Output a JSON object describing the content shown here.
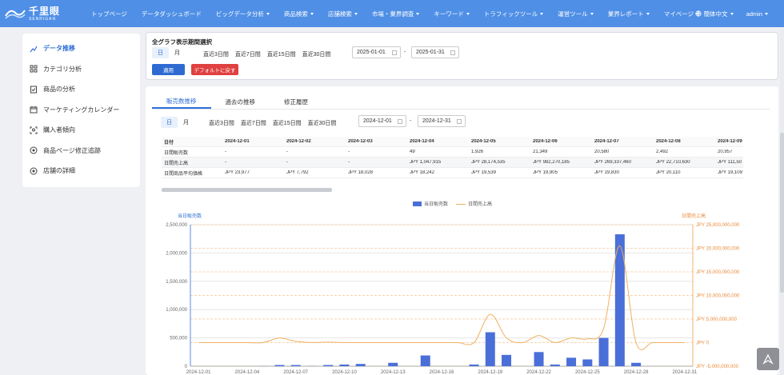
{
  "brand": {
    "name": "千里眼",
    "sub": "SENRIGAN"
  },
  "nav": [
    {
      "label": "トップページ",
      "dropdown": false
    },
    {
      "label": "データダッシュボード",
      "dropdown": false
    },
    {
      "label": "ビッグデータ分析",
      "dropdown": true
    },
    {
      "label": "商品検索",
      "dropdown": true
    },
    {
      "label": "店舗検索",
      "dropdown": true
    },
    {
      "label": "市場・業界調査",
      "dropdown": true
    },
    {
      "label": "キーワード",
      "dropdown": true
    },
    {
      "label": "トラフィックツール",
      "dropdown": true
    },
    {
      "label": "運営ツール",
      "dropdown": true
    },
    {
      "label": "業界レポート",
      "dropdown": true
    },
    {
      "label": "マイページ",
      "dropdown": true
    }
  ],
  "header_right": {
    "language": "簡体中文",
    "user": "admin"
  },
  "sidebar": [
    {
      "label": "データ推移",
      "icon": "chart-line-icon",
      "active": true
    },
    {
      "label": "カテゴリ分析",
      "icon": "grid-icon",
      "active": false
    },
    {
      "label": "商品の分析",
      "icon": "clipboard-check-icon",
      "active": false
    },
    {
      "label": "マーケティングカレンダー",
      "icon": "calendar-icon",
      "active": false
    },
    {
      "label": "購入者傾向",
      "icon": "scan-user-icon",
      "active": false
    },
    {
      "label": "商品ページ修正追跡",
      "icon": "target-icon",
      "active": false
    },
    {
      "label": "店舗の詳細",
      "icon": "target-icon",
      "active": false
    }
  ],
  "global_range": {
    "title": "全グラフ表示期間選択",
    "granularity": [
      "日",
      "月"
    ],
    "quick": [
      "直近3日間",
      "直近7日間",
      "直近15日間",
      "直近30日間"
    ],
    "start": "2025-01-01",
    "end": "2025-01-31",
    "separator": "-",
    "apply_label": "適用",
    "reset_label": "デフォルトに戻す"
  },
  "tabs": [
    "販売数推移",
    "過去の推移",
    "修正履歴"
  ],
  "local_range": {
    "granularity": [
      "日",
      "月"
    ],
    "quick": [
      "直近3日間",
      "直近7日間",
      "直近15日間",
      "直近30日間"
    ],
    "start": "2024-12-01",
    "end": "2024-12-31",
    "separator": "-"
  },
  "table": {
    "header": [
      "日付",
      "2024-12-01",
      "2024-12-02",
      "2024-12-03",
      "2024-12-04",
      "2024-12-05",
      "2024-12-06",
      "2024-12-07",
      "2024-12-08",
      "2024-12-09"
    ],
    "rows": [
      [
        "日間販売数",
        "-",
        "-",
        "-",
        "49",
        "1,926",
        "21,349",
        "20,580",
        "2,492",
        "20,957"
      ],
      [
        "日間売上高",
        "-",
        "-",
        "-",
        "JPY 1,047,915",
        "JPY 28,174,535",
        "JPY 982,270,185",
        "JPY 269,337,460",
        "JPY 22,710,630",
        "JPY 111,50"
      ],
      [
        "日間商品平均価格",
        "JPY 23,977",
        "JPY 7,792",
        "JPY 18,028",
        "JPY 18,242",
        "JPY 19,539",
        "JPY 19,905",
        "JPY 19,830",
        "JPY 20,110",
        "JPY 19,109"
      ]
    ]
  },
  "chart_data": {
    "type": "bar",
    "legend": [
      "当日販売数",
      "日間売上高"
    ],
    "legend_position": "top-center",
    "y_left_label": "当日販売数",
    "y_right_label": "日間売上高",
    "y_left_ticks": [
      "0",
      "500,000",
      "1,000,000",
      "1,500,000",
      "2,000,000",
      "2,500,000"
    ],
    "y_right_ticks": [
      "JPY -5,000,000,000",
      "JPY 0",
      "JPY 5,000,000,000",
      "JPY 10,000,000,000",
      "JPY 15,000,000,000",
      "JPY 20,000,000,000",
      "JPY 25,000,000,000"
    ],
    "x_ticks": [
      "2024-12-01",
      "2024-12-04",
      "2024-12-07",
      "2024-12-10",
      "2024-12-13",
      "2024-12-16",
      "2024-12-19",
      "2024-12-22",
      "2024-12-25",
      "2024-12-28",
      "2024-12-31"
    ],
    "ylim_left": [
      0,
      2500000
    ],
    "ylim_right": [
      -5000000000,
      25000000000
    ],
    "grid": true,
    "categories": [
      "2024-12-01",
      "2024-12-02",
      "2024-12-03",
      "2024-12-04",
      "2024-12-05",
      "2024-12-06",
      "2024-12-07",
      "2024-12-08",
      "2024-12-09",
      "2024-12-10",
      "2024-12-11",
      "2024-12-12",
      "2024-12-13",
      "2024-12-14",
      "2024-12-15",
      "2024-12-16",
      "2024-12-17",
      "2024-12-18",
      "2024-12-19",
      "2024-12-20",
      "2024-12-21",
      "2024-12-22",
      "2024-12-23",
      "2024-12-24",
      "2024-12-25",
      "2024-12-26",
      "2024-12-27",
      "2024-12-28",
      "2024-12-29",
      "2024-12-30",
      "2024-12-31"
    ],
    "series": [
      {
        "name": "当日販売数",
        "type": "bar",
        "color": "#4a6fd8",
        "values": [
          0,
          0,
          0,
          49,
          1926,
          21349,
          20580,
          2492,
          20957,
          30000,
          40000,
          0,
          60000,
          0,
          190000,
          0,
          0,
          30000,
          600000,
          200000,
          0,
          250000,
          30000,
          150000,
          120000,
          500000,
          2330000,
          60000,
          0,
          0,
          0
        ]
      },
      {
        "name": "日間売上高",
        "type": "line",
        "color": "#f0b060",
        "values": [
          0,
          0,
          0,
          1047915,
          28174535,
          982270185,
          269337460,
          22710630,
          111500000,
          0,
          0,
          0,
          0,
          0,
          0,
          0,
          0,
          0,
          6000000000,
          1000000000,
          0,
          1500000000,
          0,
          1000000000,
          800000000,
          3000000000,
          20500000000,
          0,
          0,
          0,
          0
        ]
      }
    ]
  }
}
